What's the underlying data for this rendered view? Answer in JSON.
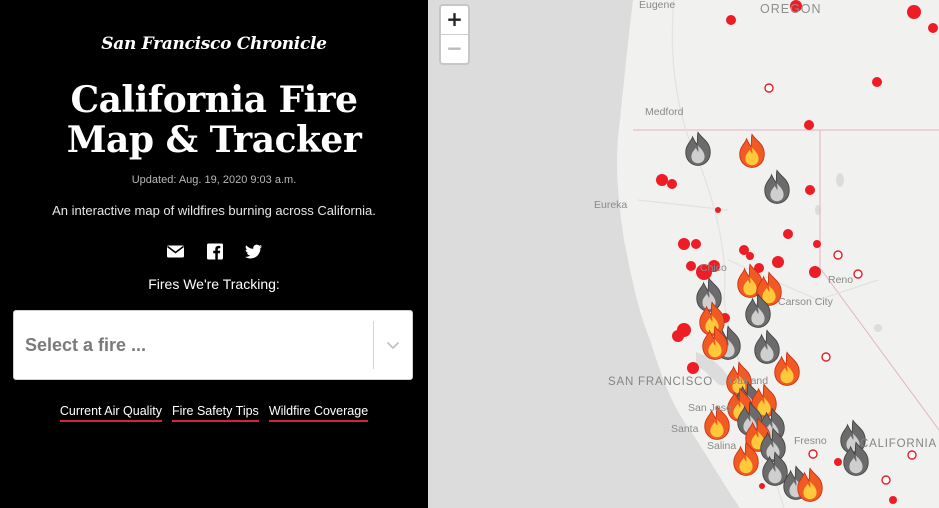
{
  "header": {
    "masthead": "San Francisco Chronicle",
    "title_line1": "California Fire",
    "title_line2": "Map & Tracker",
    "updated": "Updated: Aug. 19, 2020 9:03 a.m.",
    "description": "An interactive map of wildfires burning across California."
  },
  "share": {
    "icons": [
      "email-icon",
      "facebook-icon",
      "twitter-icon"
    ]
  },
  "tracking": {
    "heading": "Fires We're Tracking:",
    "select_placeholder": "Select a fire ..."
  },
  "links": [
    {
      "label": "Current Air Quality"
    },
    {
      "label": "Fire Safety Tips"
    },
    {
      "label": "Wildfire Coverage"
    }
  ],
  "map": {
    "zoom_in": "+",
    "zoom_out": "−",
    "labels": {
      "oregon": "OREGON",
      "eugene": "Eugene",
      "medford": "Medford",
      "eureka": "Eureka",
      "chico": "Chico",
      "reno": "Reno",
      "carson_city": "Carson City",
      "san_francisco": "SAN FRANCISCO",
      "oakland": "Oakland",
      "san_jose": "San Jose",
      "santa_cruz": "Santa",
      "salinas": "Salina",
      "fresno": "Fresno",
      "california": "CALIFORNIA"
    },
    "colors": {
      "land": "#f1f1ef",
      "water": "#dcdcdc",
      "fire_dot": "#ee1c24",
      "border": "#e6a8b4"
    }
  }
}
